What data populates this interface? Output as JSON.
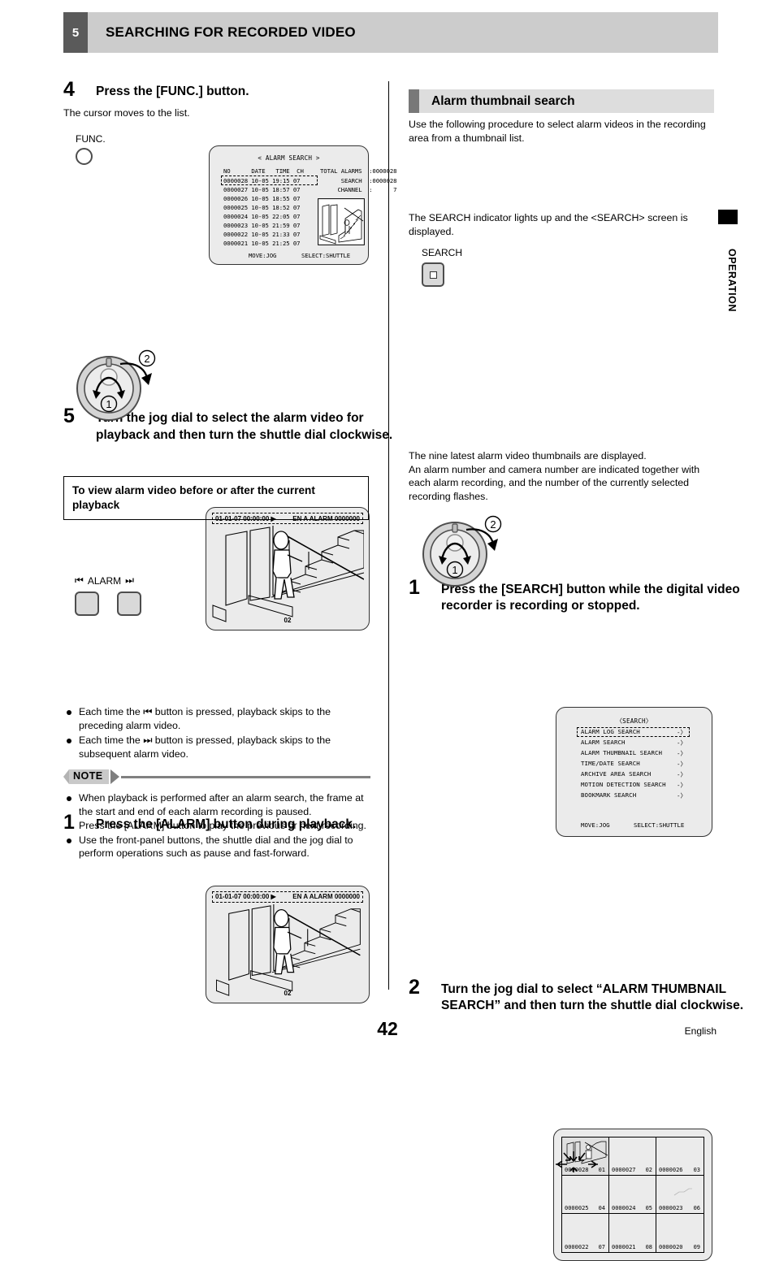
{
  "header": {
    "chapter_number": "5",
    "title": "SEARCHING FOR RECORDED VIDEO"
  },
  "side_tab": {
    "label": "OPERATION"
  },
  "footer": {
    "page_number": "42",
    "language": "English"
  },
  "left_column": {
    "step4": {
      "number": "4",
      "title": "Press the [FUNC.] button.",
      "body": "The cursor moves to the list.",
      "button_label": "FUNC.",
      "osd": {
        "title": "< ALARM SEARCH >",
        "columns": "NO      DATE   TIME  CH",
        "rows": [
          "0000028 10-05 19:15 07",
          "0000027 10-05 18:57 07",
          "0000026 10-05 18:55 07",
          "0000025 10-05 18:52 07",
          "0000024 10-05 22:05 07",
          "0000023 10-05 21:59 07",
          "0000022 10-05 21:33 07",
          "0000021 10-05 21:25 07"
        ],
        "info": [
          "TOTAL ALARMS  :0000028",
          "      SEARCH  :0000028",
          "     CHANNEL  :      7"
        ],
        "footer_move": "MOVE:JOG",
        "footer_select": "SELECT:SHUTTLE"
      }
    },
    "step5": {
      "number": "5",
      "title": "Turn the jog dial to select the alarm video for playback and then turn the shuttle dial clockwise.",
      "dial_marker_1": "1",
      "dial_marker_2": "2",
      "playback": {
        "timestamp": "01-01-07 00:00:00",
        "play_icon": "▶",
        "status": "EN A ALARM 0000000",
        "camera": "02"
      }
    },
    "subsection": {
      "title": "To view alarm video before or after the current playback"
    },
    "step1": {
      "number": "1",
      "title": "Press the [ALARM] button during playback.",
      "button_label": "ALARM",
      "prev_icon": "⏮",
      "next_icon": "⏭",
      "playback": {
        "timestamp": "01-01-07 00:00:00",
        "play_icon": "▶",
        "status": "EN A ALARM 0000000",
        "camera": "02"
      }
    },
    "bullets": [
      "Each time the ⏮ button is pressed, playback skips to the preceding alarm video.",
      "Each time the ⏭ button is pressed, playback skips to the subsequent alarm video."
    ],
    "note": {
      "label": "NOTE",
      "items": [
        "When playback is performed after an alarm search, the frame at the start and end of each alarm recording is paused.\nPress the [ALARM] button to play the previous or next recording.",
        "Use the front-panel buttons, the shuttle dial and the jog dial to perform operations such as pause and fast-forward."
      ]
    }
  },
  "right_column": {
    "section_title": "Alarm thumbnail search",
    "intro": "Use the following procedure to select alarm videos in the recording area from a thumbnail list.",
    "step1": {
      "number": "1",
      "title": "Press the [SEARCH] button while the digital video recorder is recording or stopped.",
      "body": "The SEARCH indicator lights up and the <SEARCH> screen is displayed.",
      "button_label": "SEARCH",
      "menu": {
        "title": "〈SEARCH〉",
        "items": [
          "ALARM LOG SEARCH",
          "ALARM SEARCH",
          "ALARM THUMBNAIL SEARCH",
          "TIME/DATE SEARCH",
          "ARCHIVE AREA SEARCH",
          "MOTION DETECTION SEARCH",
          "BOOKMARK SEARCH"
        ],
        "arrow": "-〉",
        "selected_index": 0,
        "footer_move": "MOVE:JOG",
        "footer_select": "SELECT:SHUTTLE"
      }
    },
    "step2": {
      "number": "2",
      "title": "Turn the jog dial to select “ALARM THUMBNAIL SEARCH” and then turn the shuttle dial clockwise.",
      "body": "The nine latest alarm video thumbnails are displayed.\nAn alarm number and camera number are indicated together with each alarm recording, and the number of the currently selected recording flashes.",
      "dial_marker_1": "1",
      "dial_marker_2": "2",
      "thumbnails": [
        {
          "alarm": "0000028",
          "cam": "01"
        },
        {
          "alarm": "0000027",
          "cam": "02"
        },
        {
          "alarm": "0000026",
          "cam": "03"
        },
        {
          "alarm": "0000025",
          "cam": "04"
        },
        {
          "alarm": "0000024",
          "cam": "05"
        },
        {
          "alarm": "0000023",
          "cam": "06"
        },
        {
          "alarm": "0000022",
          "cam": "07"
        },
        {
          "alarm": "0000021",
          "cam": "08"
        },
        {
          "alarm": "0000020",
          "cam": "09"
        }
      ]
    }
  },
  "colors": {
    "header_bar": "#cccccc",
    "chapter_tab": "#5a5a5a",
    "section_head": "#dddddd",
    "osd_bg": "#ebebeb"
  }
}
